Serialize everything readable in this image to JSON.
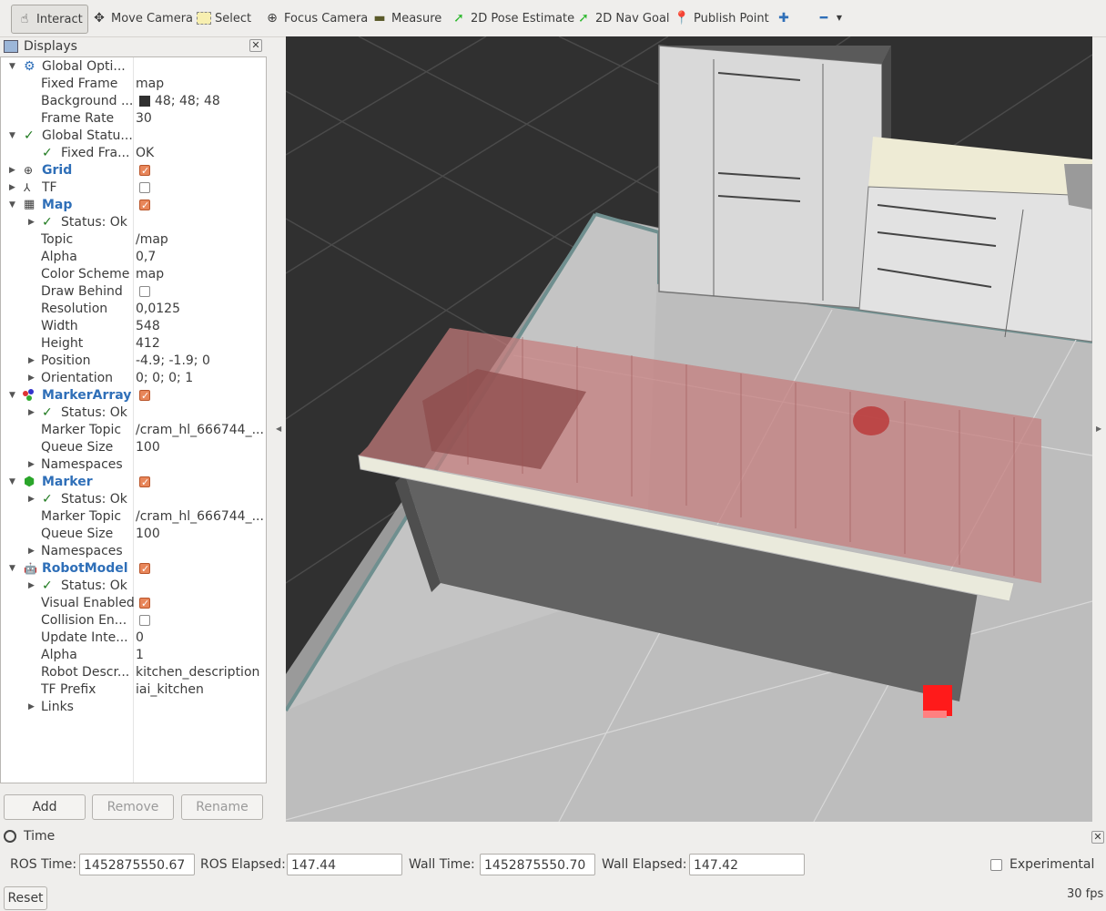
{
  "toolbar": {
    "interact": "Interact",
    "move_camera": "Move Camera",
    "select": "Select",
    "focus_camera": "Focus Camera",
    "measure": "Measure",
    "pose_estimate": "2D Pose Estimate",
    "nav_goal": "2D Nav Goal",
    "publish_point": "Publish Point"
  },
  "displays": {
    "title": "Displays",
    "rows": {
      "global_options": "Global Opti...",
      "fixed_frame": "Fixed Frame",
      "fixed_frame_val": "map",
      "background": "Background ...",
      "background_val": "48; 48; 48",
      "frame_rate": "Frame Rate",
      "frame_rate_val": "30",
      "global_status": "Global Statu...",
      "fixed_fra": "Fixed Fra...",
      "fixed_fra_val": "OK",
      "grid": "Grid",
      "tf": "TF",
      "map": "Map",
      "status_ok": "Status: Ok",
      "topic": "Topic",
      "topic_val": "/map",
      "alpha": "Alpha",
      "alpha_val": "0,7",
      "color_scheme": "Color Scheme",
      "color_scheme_val": "map",
      "draw_behind": "Draw Behind",
      "resolution": "Resolution",
      "resolution_val": "0,0125",
      "width": "Width",
      "width_val": "548",
      "height": "Height",
      "height_val": "412",
      "position": "Position",
      "position_val": "-4.9; -1.9; 0",
      "orientation": "Orientation",
      "orientation_val": "0; 0; 0; 1",
      "marker_array": "MarkerArray",
      "marker_topic": "Marker Topic",
      "marker_topic_val": "/cram_hl_666744_...",
      "queue_size": "Queue Size",
      "queue_size_val": "100",
      "namespaces": "Namespaces",
      "marker": "Marker",
      "robot_model": "RobotModel",
      "visual_enabled": "Visual Enabled",
      "collision_en": "Collision En...",
      "update_inte": "Update Inte...",
      "update_inte_val": "0",
      "alpha2_val": "1",
      "robot_descr": "Robot Descr...",
      "robot_descr_val": "kitchen_description",
      "tf_prefix": "TF Prefix",
      "tf_prefix_val": "iai_kitchen",
      "links": "Links"
    },
    "buttons": {
      "add": "Add",
      "remove": "Remove",
      "rename": "Rename"
    }
  },
  "time": {
    "title": "Time",
    "ros_time_label": "ROS Time:",
    "ros_time": "1452875550.67",
    "ros_elapsed_label": "ROS Elapsed:",
    "ros_elapsed": "147.44",
    "wall_time_label": "Wall Time:",
    "wall_time": "1452875550.70",
    "wall_elapsed_label": "Wall Elapsed:",
    "wall_elapsed": "147.42",
    "experimental": "Experimental",
    "reset": "Reset",
    "fps": "30 fps"
  },
  "colors": {
    "background": "#303030",
    "check_accent": "#e8865a",
    "link_blue": "#2f6fb8"
  }
}
